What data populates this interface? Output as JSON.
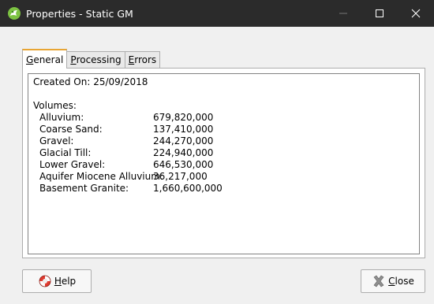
{
  "window": {
    "title": "Properties - Static GM"
  },
  "tabs": [
    {
      "label": "General",
      "accel": "G",
      "rest": "eneral",
      "active": true
    },
    {
      "label": "Processing",
      "accel": "P",
      "rest": "rocessing",
      "active": false
    },
    {
      "label": "Errors",
      "accel": "E",
      "rest": "rrors",
      "active": false
    }
  ],
  "general": {
    "created_on": "Created On: 25/09/2018",
    "volumes_heading": "Volumes:",
    "volumes": [
      {
        "name": "Alluvium:",
        "value": "679,820,000"
      },
      {
        "name": "Coarse Sand:",
        "value": "137,410,000"
      },
      {
        "name": "Gravel:",
        "value": "244,270,000"
      },
      {
        "name": "Glacial Till:",
        "value": "224,940,000"
      },
      {
        "name": "Lower Gravel:",
        "value": "646,530,000"
      },
      {
        "name": "Aquifer Miocene Alluvium:",
        "value": "36,217,000"
      },
      {
        "name": "Basement Granite:",
        "value": "1,660,600,000"
      }
    ]
  },
  "footer": {
    "help_accel": "H",
    "help_rest": "elp",
    "close_accel": "C",
    "close_rest": "lose"
  },
  "icons": {
    "app": "leapfrog-app-icon",
    "help": "lifebuoy-icon",
    "close": "x-close-icon",
    "minimize": "minimize-icon",
    "maximize": "maximize-icon",
    "window_close": "window-close-icon"
  },
  "colors": {
    "titlebar": "#2b2b2b",
    "tab_accent": "#e8a534"
  }
}
